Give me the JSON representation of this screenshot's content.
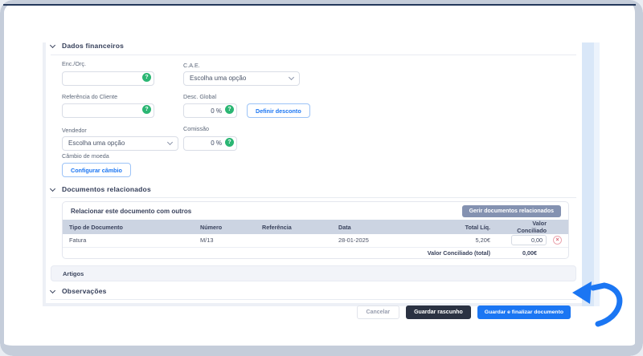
{
  "colors": {
    "accent_blue": "#1b76f3",
    "green_help": "#2bb673",
    "dark_button": "#2b3242",
    "slate_button": "#8492b1",
    "table_header_bg": "#ccd4e2",
    "frame_border": "#c5cdda",
    "danger": "#d95f6d"
  },
  "help_icon_glyph": "?",
  "remove_icon_glyph": "×",
  "financial": {
    "title": "Dados financeiros",
    "enc_orc": {
      "label": "Enc./Orç.",
      "value": ""
    },
    "cae": {
      "label": "C.A.E.",
      "value": "Escolha uma opção"
    },
    "ref_cliente": {
      "label": "Referência do Cliente",
      "value": ""
    },
    "desc_global": {
      "label": "Desc. Global",
      "value": "0 %"
    },
    "definir_desconto_button": "Definir desconto",
    "vendedor": {
      "label": "Vendedor",
      "value": "Escolha uma opção"
    },
    "comissao": {
      "label": "Comissão",
      "value": "0 %"
    },
    "cambio": {
      "label": "Câmbio de moeda",
      "button": "Configurar câmbio"
    }
  },
  "related_docs": {
    "title": "Documentos relacionados",
    "panel_title": "Relacionar este documento com outros",
    "manage_button": "Gerir documentos relacionados",
    "table": {
      "headers": [
        "Tipo de Documento",
        "Número",
        "Referência",
        "Data",
        "Total Líq.",
        "Valor Conciliado"
      ],
      "row": {
        "tipo": "Fatura",
        "numero": "M/13",
        "referencia": "",
        "data": "28-01-2025",
        "total_liq": "5,20€",
        "valor_conciliado": "0,00"
      },
      "footer_label": "Valor Conciliado (total)",
      "footer_value": "0,00€"
    }
  },
  "artigos": {
    "title": "Artigos"
  },
  "observacoes": {
    "title": "Observações"
  },
  "footer_buttons": {
    "cancel": "Cancelar",
    "draft": "Guardar rascunho",
    "finalize": "Guardar e finalizar documento"
  }
}
